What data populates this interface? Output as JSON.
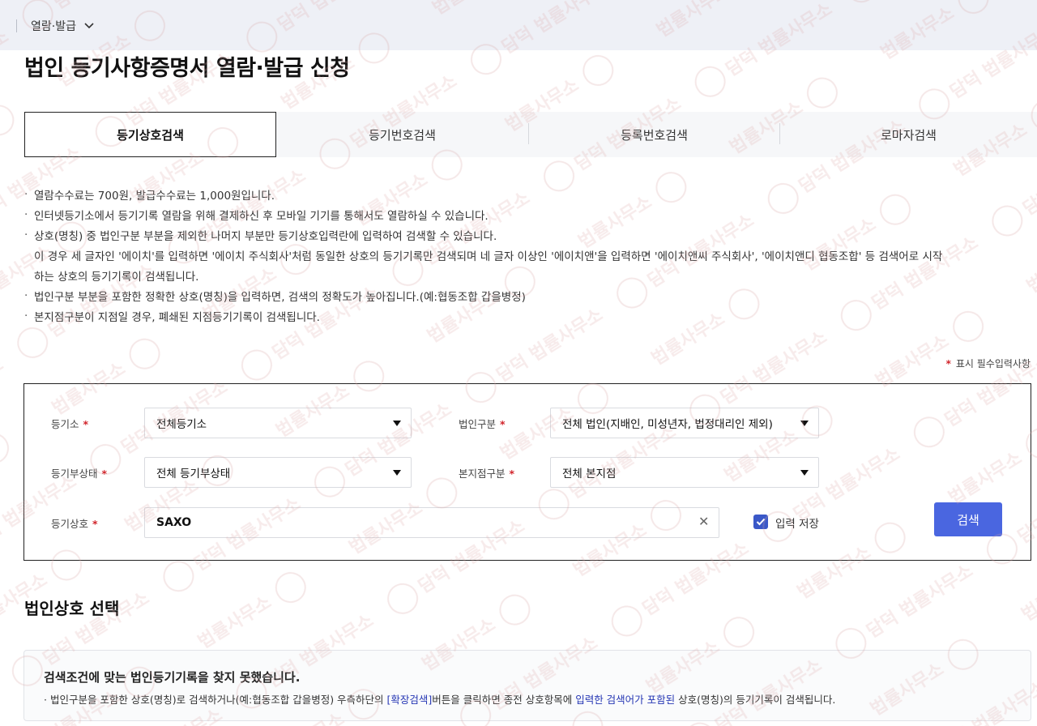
{
  "breadcrumb": {
    "label": "열람·발급"
  },
  "page_title": "법인 등기사항증명서 열람·발급 신청",
  "tabs": [
    {
      "label": "등기상호검색",
      "active": true
    },
    {
      "label": "등기번호검색",
      "active": false
    },
    {
      "label": "등록번호검색",
      "active": false
    },
    {
      "label": "로마자검색",
      "active": false
    }
  ],
  "notes": [
    "열람수수료는 700원, 발급수수료는 1,000원입니다.",
    "인터넷등기소에서 등기기록 열람을 위해 결제하신 후 모바일 기기를 통해서도 열람하실 수 있습니다.",
    "상호(명칭) 중 법인구분 부분을 제외한 나머지 부분만 등기상호입력란에 입력하여 검색할 수 있습니다.",
    "이 경우 세 글자인 '에이치'를 입력하면 '에이치 주식회사'처럼 동일한 상호의 등기기록만 검색되며 네 글자 이상인 '에이치앤'을 입력하면 '에이치앤씨 주식회사', '에이치앤디 협동조합' 등 검색어로 시작",
    "하는 상호의 등기기록이 검색됩니다.",
    "법인구분 부분을 포함한 정확한 상호(명칭)을 입력하면, 검색의 정확도가 높아집니다.(예:협동조합 갑을병정)",
    "본지점구분이 지점일 경우, 폐쇄된 지점등기기록이 검색됩니다."
  ],
  "required_hint": "표시 필수입력사항",
  "required_mark": "*",
  "form": {
    "registry_office": {
      "label": "등기소",
      "value": "전체등기소"
    },
    "corp_type": {
      "label": "법인구분",
      "value": "전체 법인(지배인, 미성년자, 법정대리인 제외)"
    },
    "registry_status": {
      "label": "등기부상태",
      "value": "전체 등기부상태"
    },
    "branch_type": {
      "label": "본지점구분",
      "value": "전체 본지점"
    },
    "corp_name": {
      "label": "등기상호",
      "value": "SAXO"
    },
    "save_input": {
      "label": "입력 저장",
      "checked": true
    },
    "search_button": "검색"
  },
  "result_section": {
    "title": "법인상호 선택",
    "message_title": "검색조건에 맞는 법인등기기록을 찾지 못했습니다.",
    "message_part1": "법인구분을 포함한 상호(명칭)로 검색하거나(예:협동조합 갑을병정) 우측하단의 ",
    "message_link1": "[확장검색]",
    "message_part2": "버튼을 클릭하면 종전 상호항목에 ",
    "message_link2": "입력한 검색어가 포함된",
    "message_part3": " 상호(명칭)의 등기기록이 검색됩니다."
  },
  "watermark_text": "담덕 법률사무소",
  "colors": {
    "accent": "#4a66e0",
    "required": "#d1232a",
    "topbar_bg": "#eef0f6",
    "link": "#2637b4"
  }
}
